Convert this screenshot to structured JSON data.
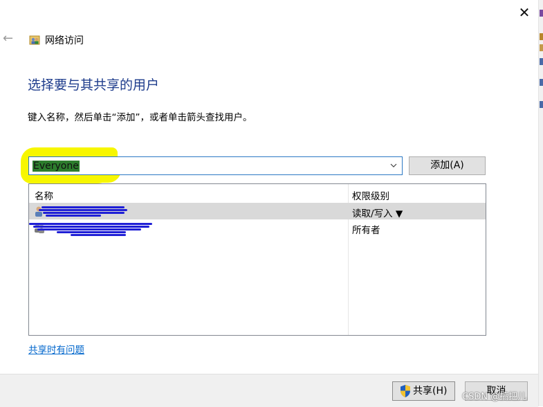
{
  "window": {
    "title": "网络访问",
    "back_icon": "back-arrow-icon",
    "close_icon": "close-icon"
  },
  "main": {
    "heading": "选择要与其共享的用户",
    "instruction": "键入名称，然后单击“添加”，或者单击箭头查找用户。"
  },
  "user_input": {
    "value": "Everyone",
    "dropdown_icon": "chevron-down-icon"
  },
  "add_button": {
    "label": "添加(A)"
  },
  "users_table": {
    "columns": [
      "名称",
      "权限级别"
    ],
    "rows": [
      {
        "name": "",
        "permission": "读取/写入 ▼",
        "selected": true,
        "icon": "user-icon"
      },
      {
        "name": "",
        "permission": "所有者",
        "selected": false,
        "icon": "user-group-icon"
      }
    ]
  },
  "help_link": {
    "label": "共享时有问题"
  },
  "footer": {
    "share_label": "共享(H)",
    "cancel_label": "取消"
  },
  "watermark": "CSDN @搞把儿",
  "colors": {
    "heading": "#1e3c8c",
    "link": "#0066cc",
    "input_border": "#2b78c4",
    "highlight": "#f7f600",
    "scribble": "#1f1fd6"
  }
}
